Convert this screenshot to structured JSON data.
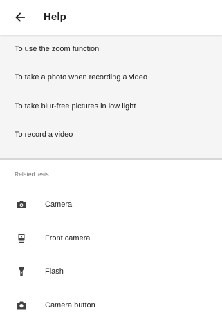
{
  "appbar": {
    "back_icon": "arrow-back-icon",
    "title": "Help"
  },
  "help_topics": [
    {
      "label": "To use the zoom function"
    },
    {
      "label": "To take a photo when recording a video"
    },
    {
      "label": "To take blur-free pictures in low light"
    },
    {
      "label": "To record a video"
    }
  ],
  "related": {
    "header": "Related tests",
    "items": [
      {
        "label": "Camera",
        "icon": "camera-icon"
      },
      {
        "label": "Front camera",
        "icon": "front-camera-icon"
      },
      {
        "label": "Flash",
        "icon": "flashlight-icon"
      },
      {
        "label": "Camera button",
        "icon": "camera-button-icon"
      }
    ]
  },
  "colors": {
    "appbar_bg": "#ffffff",
    "topics_bg": "#f5f5f5",
    "text": "#212121",
    "secondary_text": "#757575",
    "icon": "#424242"
  }
}
